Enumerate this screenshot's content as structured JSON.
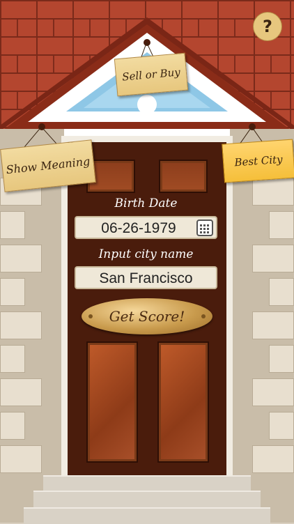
{
  "signs": {
    "sell_or_buy": "Sell or Buy",
    "show_meaning": "Show Meaning",
    "best_city": "Best City"
  },
  "help": {
    "label": "?"
  },
  "form": {
    "birth_date_label": "Birth Date",
    "birth_date_value": "06-26-1979",
    "city_label": "Input city name",
    "city_value": "San Francisco",
    "submit_label": "Get Score!"
  },
  "colors": {
    "brick": "#b4462f",
    "door": "#4a1c0c",
    "sign": "#e7c77e",
    "sign_highlight": "#f5bf3a"
  }
}
